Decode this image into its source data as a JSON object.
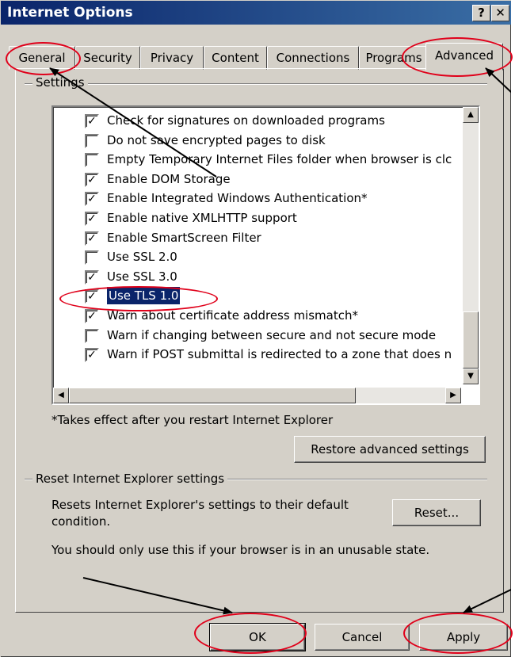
{
  "window": {
    "title": "Internet Options",
    "help_label": "?",
    "close_label": "✕"
  },
  "tabs": [
    {
      "label": "General",
      "active": false
    },
    {
      "label": "Security",
      "active": false
    },
    {
      "label": "Privacy",
      "active": false
    },
    {
      "label": "Content",
      "active": false
    },
    {
      "label": "Connections",
      "active": false
    },
    {
      "label": "Programs",
      "active": false
    },
    {
      "label": "Advanced",
      "active": true
    }
  ],
  "settings": {
    "group_label": "Settings",
    "items": [
      {
        "label": "Check for signatures on downloaded programs",
        "checked": true
      },
      {
        "label": "Do not save encrypted pages to disk",
        "checked": false
      },
      {
        "label": "Empty Temporary Internet Files folder when browser is clc",
        "checked": false
      },
      {
        "label": "Enable DOM Storage",
        "checked": true
      },
      {
        "label": "Enable Integrated Windows Authentication*",
        "checked": true
      },
      {
        "label": "Enable native XMLHTTP support",
        "checked": true
      },
      {
        "label": "Enable SmartScreen Filter",
        "checked": true
      },
      {
        "label": "Use SSL 2.0",
        "checked": false
      },
      {
        "label": "Use SSL 3.0",
        "checked": true
      },
      {
        "label": "Use TLS 1.0",
        "checked": true,
        "selected": true
      },
      {
        "label": "Warn about certificate address mismatch*",
        "checked": true
      },
      {
        "label": "Warn if changing between secure and not secure mode",
        "checked": false
      },
      {
        "label": "Warn if POST submittal is redirected to a zone that does n",
        "checked": true
      }
    ],
    "note": "*Takes effect after you restart Internet Explorer",
    "restore_button": "Restore advanced settings"
  },
  "reset": {
    "group_label": "Reset Internet Explorer settings",
    "description_line1": "Resets Internet Explorer's settings to their default",
    "description_line2": "condition.",
    "button": "Reset...",
    "warning": "You should only use this if your browser is in an unusable state."
  },
  "footer": {
    "ok": "OK",
    "cancel": "Cancel",
    "apply": "Apply"
  },
  "annotation": {
    "color": "#e0001a",
    "arrow_color": "#000000"
  }
}
